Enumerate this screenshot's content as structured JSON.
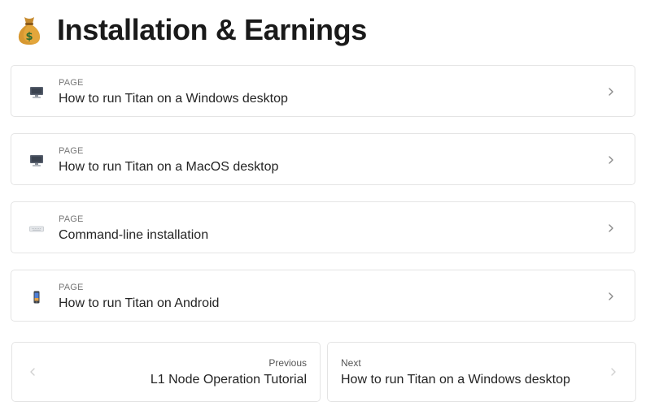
{
  "header": {
    "title": "Installation & Earnings",
    "icon": "money-bag-icon"
  },
  "cards": [
    {
      "kicker": "PAGE",
      "title": "How to run Titan on a Windows desktop",
      "icon": "desktop-computer-icon"
    },
    {
      "kicker": "PAGE",
      "title": "How to run Titan on a MacOS desktop",
      "icon": "desktop-computer-icon"
    },
    {
      "kicker": "PAGE",
      "title": "Command-line installation",
      "icon": "keyboard-icon"
    },
    {
      "kicker": "PAGE",
      "title": "How to run Titan on Android",
      "icon": "mobile-phone-icon"
    }
  ],
  "pagination": {
    "previous_label": "Previous",
    "previous_title": "L1 Node Operation Tutorial",
    "next_label": "Next",
    "next_title": "How to run Titan on a Windows desktop"
  },
  "colors": {
    "border": "#e4e4e4",
    "text": "#242424",
    "muted": "#777777",
    "chevron": "#8a8a8a",
    "chevron_disabled": "#d0d0d0"
  }
}
